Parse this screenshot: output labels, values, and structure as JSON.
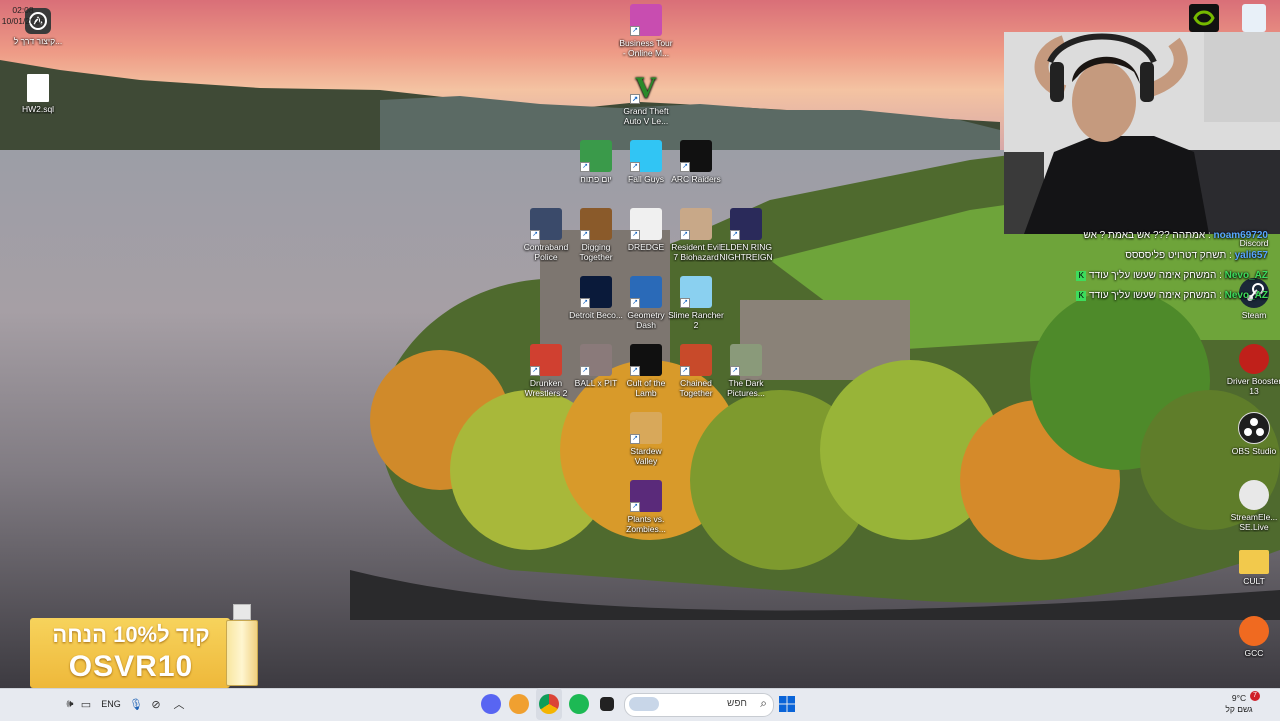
{
  "desktop": {
    "left_icons": [
      {
        "label": "קיצור דרך ל...",
        "icon": "app-shortcut-icon"
      },
      {
        "label": "HW2.sql",
        "icon": "file-icon"
      }
    ],
    "center_icons": [
      {
        "label": "Business Tour - Online M...",
        "icon": "business-tour-icon",
        "color": "#c84db0"
      },
      {
        "label": "Grand Theft Auto V Le...",
        "icon": "gta-v-icon",
        "color": "#2a8a2a"
      },
      {
        "label": "יום פתוח",
        "icon": "game-icon",
        "color": "#3a9a4a"
      },
      {
        "label": "Fall Guys",
        "icon": "fall-guys-icon",
        "color": "#31c5f4"
      },
      {
        "label": "ARC Raiders",
        "icon": "arc-raiders-icon",
        "color": "#111111"
      },
      {
        "label": "Contraband Police",
        "icon": "contraband-police-icon",
        "color": "#3a4a6a"
      },
      {
        "label": "Digging Together",
        "icon": "digging-together-icon",
        "color": "#8a5a2a"
      },
      {
        "label": "DREDGE",
        "icon": "dredge-icon",
        "color": "#f0f0f0"
      },
      {
        "label": "Resident Evil 7 Biohazard",
        "icon": "resident-evil-icon",
        "color": "#c8a888"
      },
      {
        "label": "ELDEN RING NIGHTREIGN",
        "icon": "elden-ring-icon",
        "color": "#2a2a5a"
      },
      {
        "label": "Detroit Beco...",
        "icon": "detroit-icon",
        "color": "#0a1a3a"
      },
      {
        "label": "Geometry Dash",
        "icon": "geometry-dash-icon",
        "color": "#2a6ab8"
      },
      {
        "label": "Slime Rancher 2",
        "icon": "slime-rancher-icon",
        "color": "#8ad0f0"
      },
      {
        "label": "Drunken Wrestlers 2",
        "icon": "drunken-wrestlers-icon",
        "color": "#d04030"
      },
      {
        "label": "BALL x PIT",
        "icon": "ball-x-pit-icon",
        "color": "#8a7a7a"
      },
      {
        "label": "Cult of the Lamb",
        "icon": "cult-of-the-lamb-icon",
        "color": "#101010"
      },
      {
        "label": "Chained Together",
        "icon": "chained-together-icon",
        "color": "#c84a2a"
      },
      {
        "label": "The Dark Pictures...",
        "icon": "dark-pictures-icon",
        "color": "#8a9a7a"
      },
      {
        "label": "Stardew Valley",
        "icon": "stardew-valley-icon",
        "color": "#d8a85a"
      },
      {
        "label": "Plants vs. Zombies...",
        "icon": "plants-vs-zombies-icon",
        "color": "#5a2a7a"
      }
    ],
    "right_icons": [
      {
        "label": "",
        "icon": "nvidia-icon",
        "color": "#111111"
      },
      {
        "label": "",
        "icon": "recycle-bin-icon",
        "color": "#e8f0f8"
      },
      {
        "label": "Discord",
        "icon": "discord-icon",
        "color": "#5865f2"
      },
      {
        "label": "Steam",
        "icon": "steam-icon",
        "color": "#1b2838"
      },
      {
        "label": "Driver Booster 13",
        "icon": "driver-booster-icon",
        "color": "#c0201a"
      },
      {
        "label": "OBS Studio",
        "icon": "obs-icon",
        "color": "#1e1e1e"
      },
      {
        "label": "StreamEle... SE.Live",
        "icon": "streamelements-icon",
        "color": "#e8e8e8"
      },
      {
        "label": "CULT",
        "icon": "folder-icon",
        "color": "#f2c94c"
      },
      {
        "label": "GCC",
        "icon": "gcc-icon",
        "color": "#f06a20"
      }
    ]
  },
  "chat": {
    "messages": [
      {
        "user": "noam69720",
        "text": "אמתהה ??? אש באמת ? אש",
        "color": "#58a6ff"
      },
      {
        "user": "yali657",
        "text": "תשחק דטרויט פליסססס",
        "color": "#58a6ff"
      },
      {
        "user": "Nevo_AZ",
        "text": "המשחק אימה שעשו עליך עודד",
        "color": "#3ddc5c"
      },
      {
        "user": "Nevo_AZ",
        "text": "המשחק אימה שעשו עליך עודד",
        "color": "#3ddc5c"
      }
    ]
  },
  "promo": {
    "headline": "קוד ל10% הנחה",
    "code": "OSVR10",
    "bg": "#f5c84a"
  },
  "taskbar": {
    "clock_time": "02:08",
    "clock_date": "10/01/2026",
    "language": "ENG",
    "search_placeholder": "חפש",
    "weather_temp": "9°C",
    "weather_text": "גשם קל",
    "weather_badge": "7",
    "accent": "#0a64d8"
  }
}
